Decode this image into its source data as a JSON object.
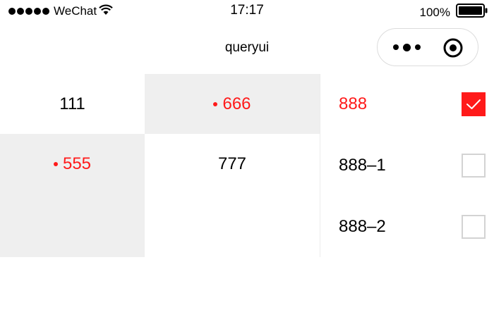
{
  "status_bar": {
    "carrier": "WeChat",
    "time": "17:17",
    "battery": "100%"
  },
  "nav": {
    "title": "queryui"
  },
  "menu": {
    "col1": [
      {
        "label": "111",
        "selected": false
      },
      {
        "label": "555",
        "selected": true
      }
    ],
    "col2": [
      {
        "label": "666",
        "selected": true
      },
      {
        "label": "777",
        "selected": false
      }
    ],
    "col3": [
      {
        "label": "888",
        "checked": true
      },
      {
        "label": "888–1",
        "checked": false
      },
      {
        "label": "888–2",
        "checked": false
      }
    ]
  },
  "colors": {
    "accent": "#ff1a1a",
    "grey_bg": "#efefef",
    "checkbox_border": "#d3d3d3"
  }
}
